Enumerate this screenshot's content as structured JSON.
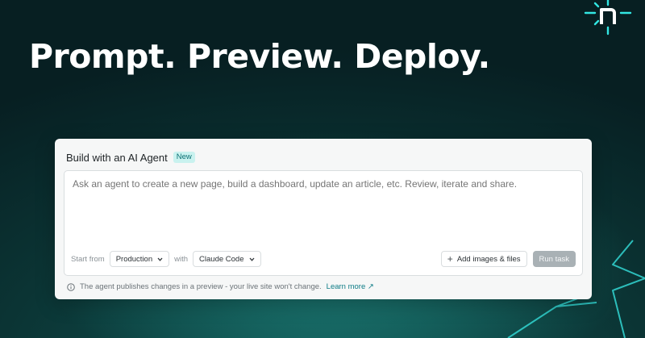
{
  "brand": {
    "logo_icon": "netlify-n-logo-icon",
    "accent": "#32e6e2"
  },
  "headline": "Prompt. Preview. Deploy.",
  "card": {
    "title": "Build with an AI Agent",
    "badge": "New",
    "prompt_placeholder": "Ask an agent to create a new page, build a dashboard, update an article, etc. Review, iterate and share.",
    "start_from_label": "Start from",
    "start_from_value": "Production",
    "with_label": "with",
    "agent_value": "Claude Code",
    "add_files_label": "Add images & files",
    "run_label": "Run task",
    "note": "The agent publishes changes in a preview - your live site won't change.",
    "learn_more": "Learn more ↗"
  }
}
